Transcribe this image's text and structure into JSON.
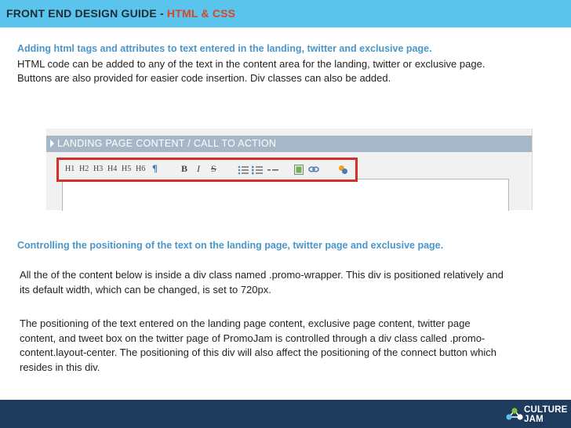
{
  "header": {
    "title": "FRONT END DESIGN GUIDE - ",
    "highlight": "HTML & CSS"
  },
  "section1": {
    "heading": "Adding html tags and attributes to text entered in the landing, twitter and exclusive page.",
    "body": "HTML code can be added to any of the text in the content area for the landing, twitter or exclusive page. Buttons are also provided for easier code insertion. Div classes can also be added."
  },
  "screenshot": {
    "panel_title": "LANDING PAGE CONTENT / CALL TO ACTION",
    "toolbar": {
      "h1": "H1",
      "h2": "H2",
      "h3": "H3",
      "h4": "H4",
      "h5": "H5",
      "h6": "H6",
      "paragraph": "¶",
      "bold": "B",
      "italic": "I",
      "strike": "S"
    }
  },
  "section2": {
    "heading": "Controlling the positioning of the text on the landing page, twitter page and exclusive page.",
    "para1": "All the of the content below is inside a div class named .promo-wrapper. This div is positioned relatively and its default width, which can be changed, is set to 720px.",
    "para2": "The positioning of the text entered on the landing page content, exclusive page content, twitter page content, and tweet box on the twitter page of PromoJam is controlled through a div class called .promo-content.layout-center. The positioning of this div will also affect the positioning of the connect button which resides in this div."
  },
  "footer": {
    "logo_line1": "CULTURE",
    "logo_line2": "JAM"
  },
  "colors": {
    "topbar": "#5bc4ec",
    "accent": "#d8462a",
    "heading": "#4b95c9",
    "footer": "#1e3a5c",
    "toolbar_highlight": "#d62e2a"
  }
}
